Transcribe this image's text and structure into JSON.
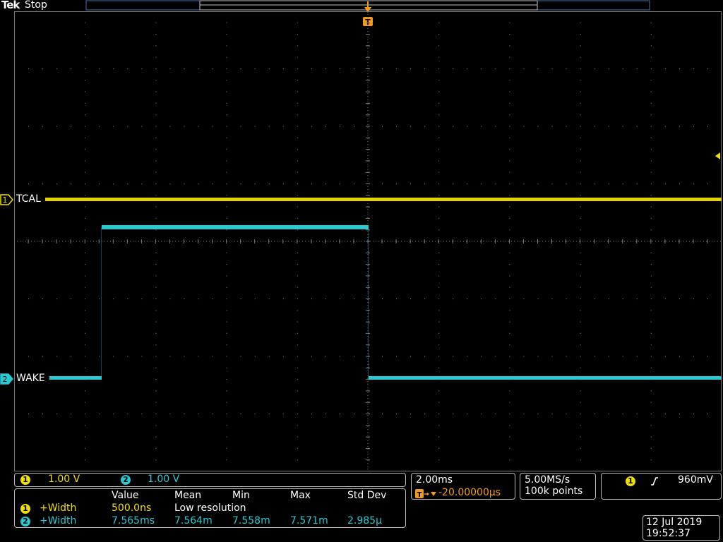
{
  "header": {
    "brand": "Tek",
    "acq_state": "Stop"
  },
  "trigger_marker": {
    "label": "T"
  },
  "channels": [
    {
      "number": "1",
      "name": "TCAL",
      "scale": "1.00 V",
      "color": "#f0e000"
    },
    {
      "number": "2",
      "name": "WAKE",
      "scale": "1.00 V",
      "color": "#29c9d2"
    }
  ],
  "measurements": {
    "columns": [
      "Value",
      "Mean",
      "Min",
      "Max",
      "Std Dev"
    ],
    "rows": [
      {
        "channel": "1",
        "name": "+Width",
        "value": "500.0ns",
        "mean": "Low resolution",
        "min": "",
        "max": "",
        "std": ""
      },
      {
        "channel": "2",
        "name": "+Width",
        "value": "7.565ms",
        "mean": "7.564m",
        "min": "7.558m",
        "max": "7.571m",
        "std": "2.985µ"
      }
    ]
  },
  "timebase": {
    "scale": "2.00ms",
    "delay": "-20.00000µs"
  },
  "acquisition": {
    "rate": "5.00MS/s",
    "points": "100k points"
  },
  "trigger": {
    "source": "1",
    "slope": "rising",
    "level": "960mV"
  },
  "datetime": {
    "date": "12 Jul  2019",
    "time": "19:52:37"
  },
  "colors": {
    "ch1": "#f0e000",
    "ch2": "#29c9d2",
    "trigger": "#f29a1c",
    "grid": "#7a7a7a"
  }
}
